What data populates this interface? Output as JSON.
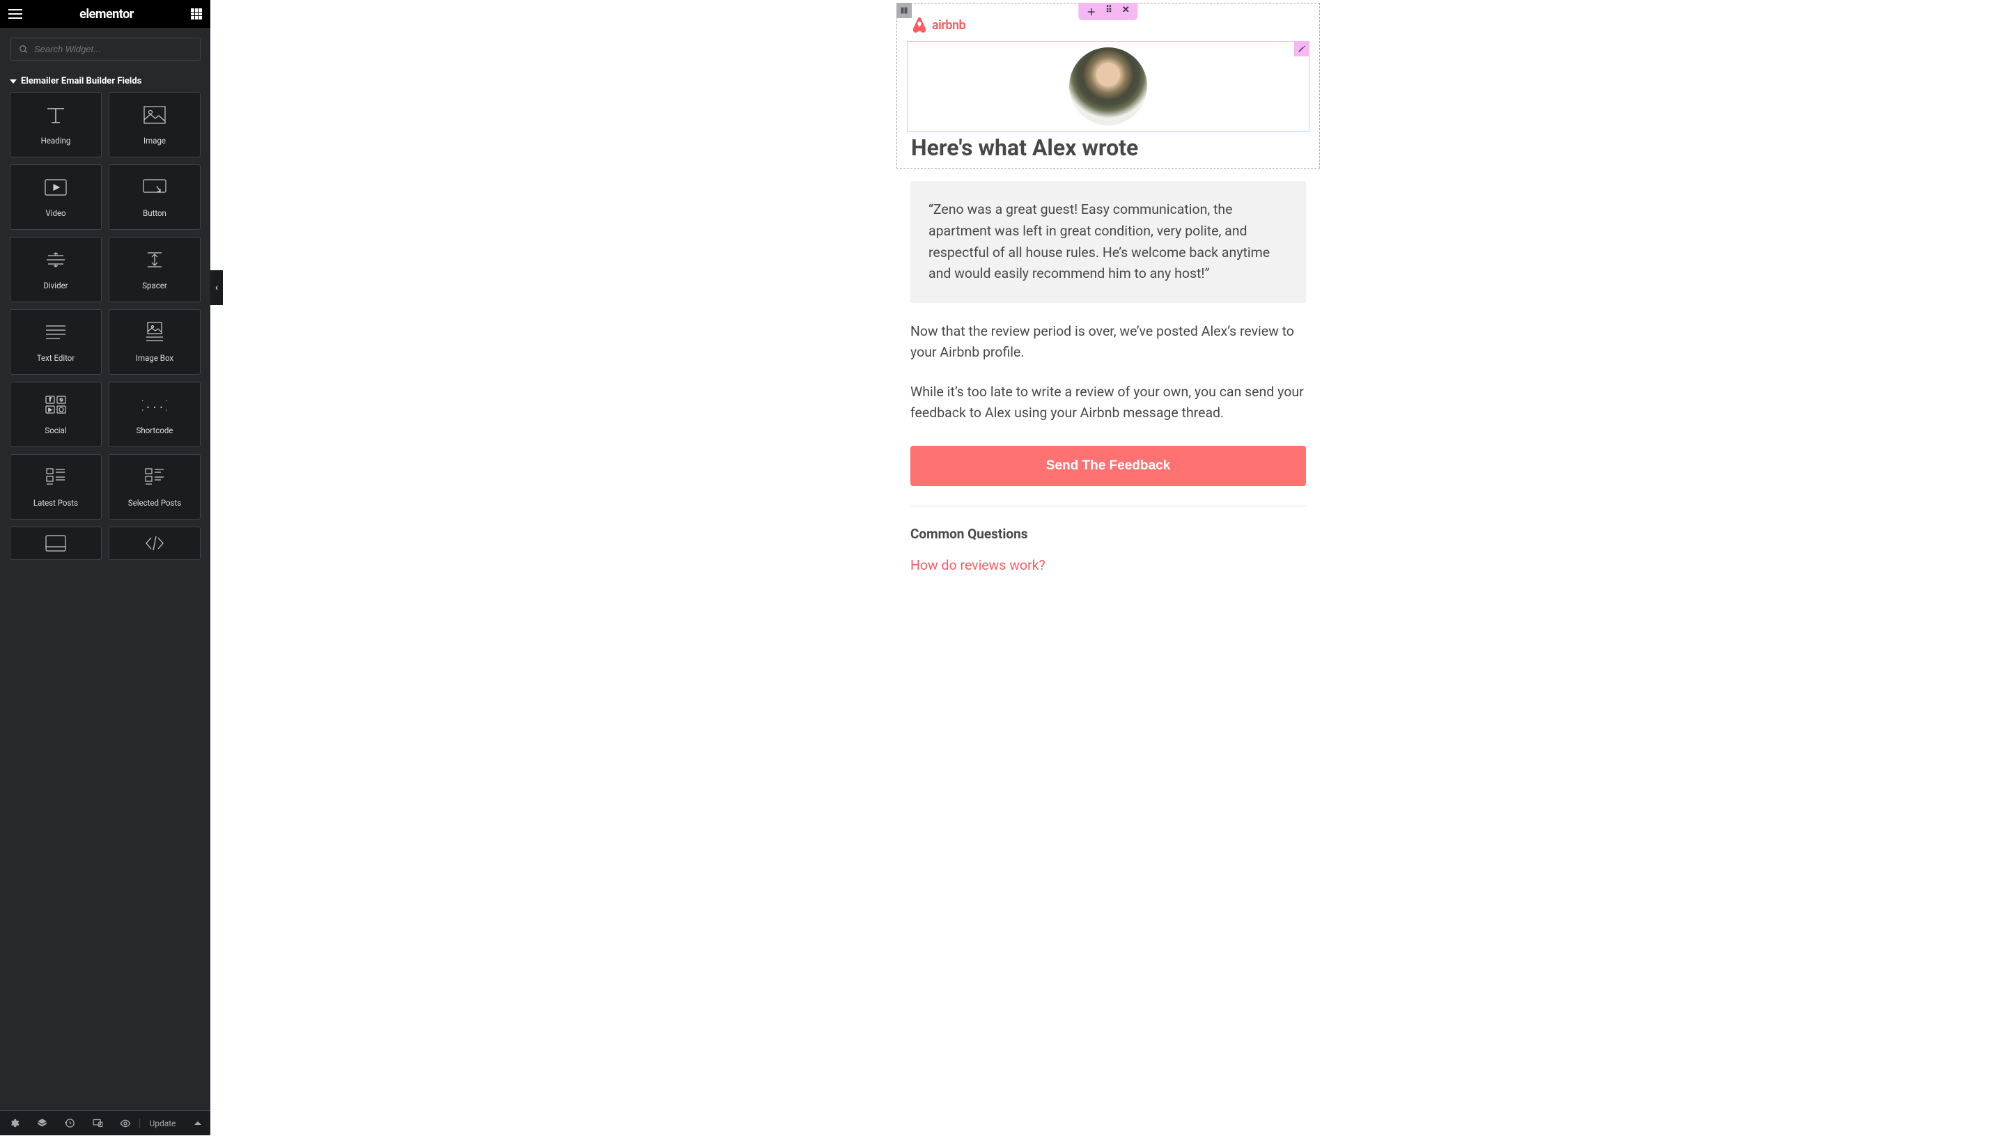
{
  "sidebar": {
    "brand": "elementor",
    "search_placeholder": "Search Widget...",
    "category_title": "Elemailer Email Builder Fields",
    "widgets": [
      {
        "label": "Heading"
      },
      {
        "label": "Image"
      },
      {
        "label": "Video"
      },
      {
        "label": "Button"
      },
      {
        "label": "Divider"
      },
      {
        "label": "Spacer"
      },
      {
        "label": "Text Editor"
      },
      {
        "label": "Image Box"
      },
      {
        "label": "Social"
      },
      {
        "label": "Shortcode"
      },
      {
        "label": "Latest Posts"
      },
      {
        "label": "Selected Posts"
      }
    ],
    "footer": {
      "update_label": "Update"
    }
  },
  "email": {
    "logo_text": "airbnb",
    "heading": "Here's what Alex wrote",
    "quote": "“Zeno was a great guest! Easy communication, the apartment was left in great condition, very polite, and respectful of all house rules. He’s welcome back anytime and would easily recommend him to any host!”",
    "para1": "Now that the review period is over, we’ve posted Alex’s review to your Airbnb profile.",
    "para2": "While it’s too late to write a review of your own, you can send your feedback to Alex using your Airbnb message thread.",
    "cta_label": "Send The Feedback",
    "faq_heading": "Common Questions",
    "faq_link1": "How do reviews work?"
  }
}
